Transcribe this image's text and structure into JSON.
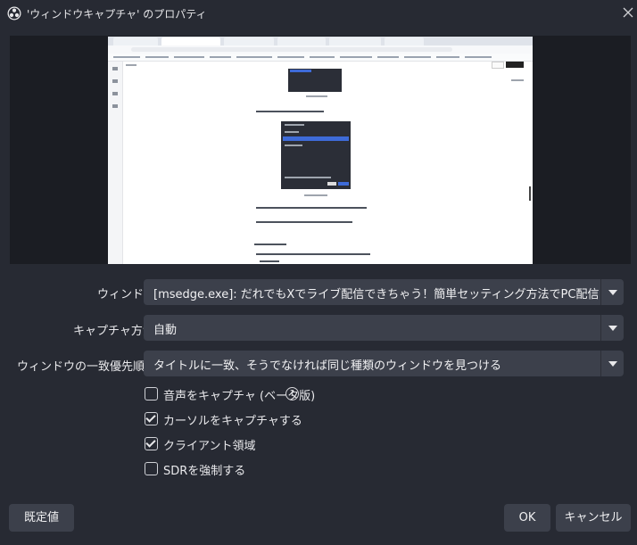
{
  "window": {
    "title": "'ウィンドウキャプチャ' のプロパティ"
  },
  "form": {
    "window_label": "ウィンドウ",
    "window_value": "[msedge.exe]: だれでもXでライブ配信できちゃう！簡単セッティング方法でPC配信デビューしよう | Sm",
    "capture_label": "キャプチャ方法",
    "capture_value": "自動",
    "priority_label": "ウィンドウの一致優先順位",
    "priority_value": "タイトルに一致、そうでなければ同じ種類のウィンドウを見つける"
  },
  "checkboxes": [
    {
      "label": "音声をキャプチャ (ベータ版)",
      "checked": false
    },
    {
      "label": "カーソルをキャプチャする",
      "checked": true
    },
    {
      "label": "クライアント領域",
      "checked": true
    },
    {
      "label": "SDRを強制する",
      "checked": false
    }
  ],
  "help_glyph": "?",
  "buttons": {
    "defaults": "既定値",
    "ok": "OK",
    "cancel": "キャンセル"
  },
  "colors": {
    "background": "#272a33",
    "field": "#3c404b",
    "preview_bg": "#1b1d23"
  }
}
